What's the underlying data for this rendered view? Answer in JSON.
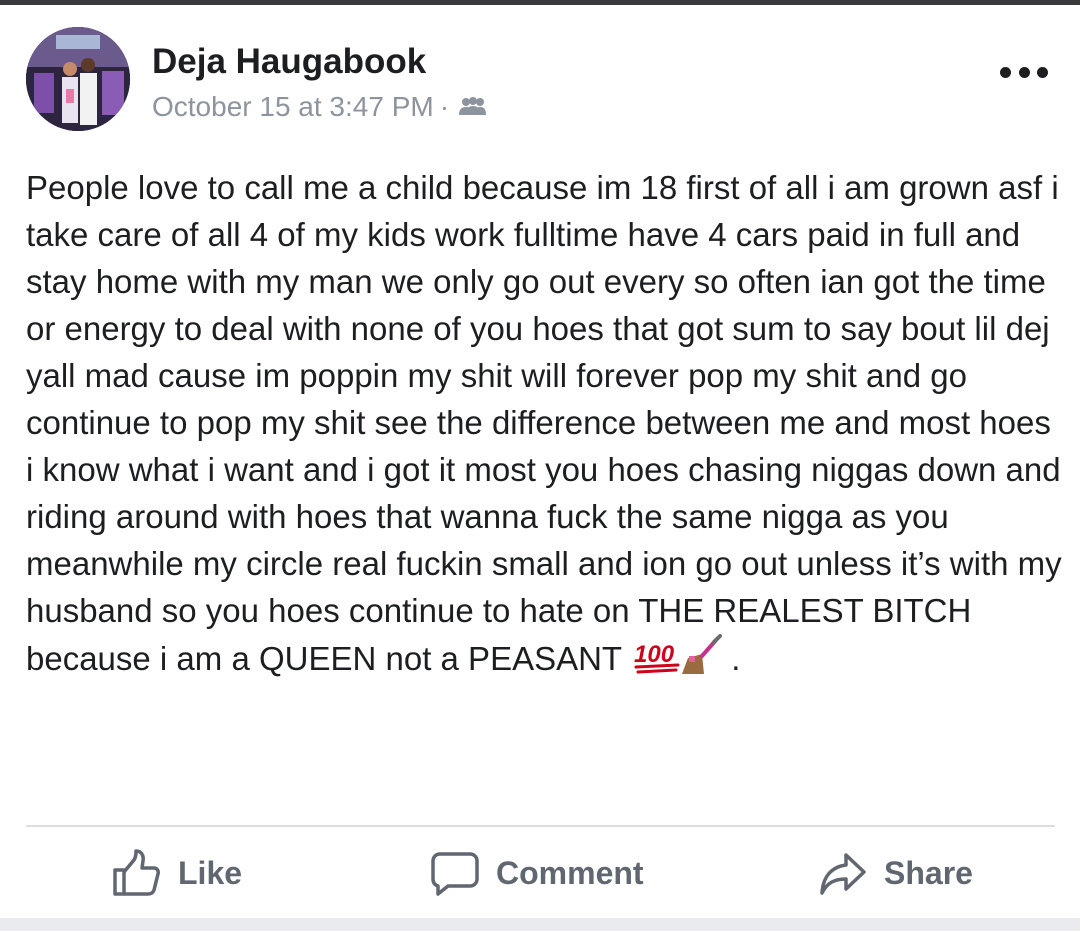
{
  "post": {
    "author": "Deja Haugabook",
    "date": "October 15 at 3:47 PM",
    "separator": "·",
    "audience_icon": "friends-icon",
    "more_icon": "more-options-icon",
    "text": "People love to call me a child because im 18 first of all i am grown asf i take care of all 4 of my kids work fulltime have 4 cars paid in full and stay home with my man we only go out every so often ian got the time or energy to deal with none of you hoes that got sum to say bout lil dej yall mad cause im poppin my shit will forever pop my shit and go continue to pop my shit see the difference between me and most hoes i know what i want and i got it most you hoes chasing niggas down and riding around with hoes that wanna fuck the same nigga as you meanwhile my circle real fuckin small and ion go out unless it’s with my husband so you hoes continue to hate on THE REALEST BITCH because i am a QUEEN not a PEASANT",
    "emojis": [
      "hundred-points-emoji",
      "nail-polish-emoji"
    ],
    "text_end": "."
  },
  "actions": {
    "like": {
      "label": "Like",
      "icon": "thumbs-up-icon"
    },
    "comment": {
      "label": "Comment",
      "icon": "comment-bubble-icon"
    },
    "share": {
      "label": "Share",
      "icon": "share-arrow-icon"
    }
  },
  "colors": {
    "text": "#1c1e21",
    "meta": "#8d949e",
    "action": "#606770",
    "divider": "#dadde1",
    "emoji_red": "#d0021b"
  }
}
